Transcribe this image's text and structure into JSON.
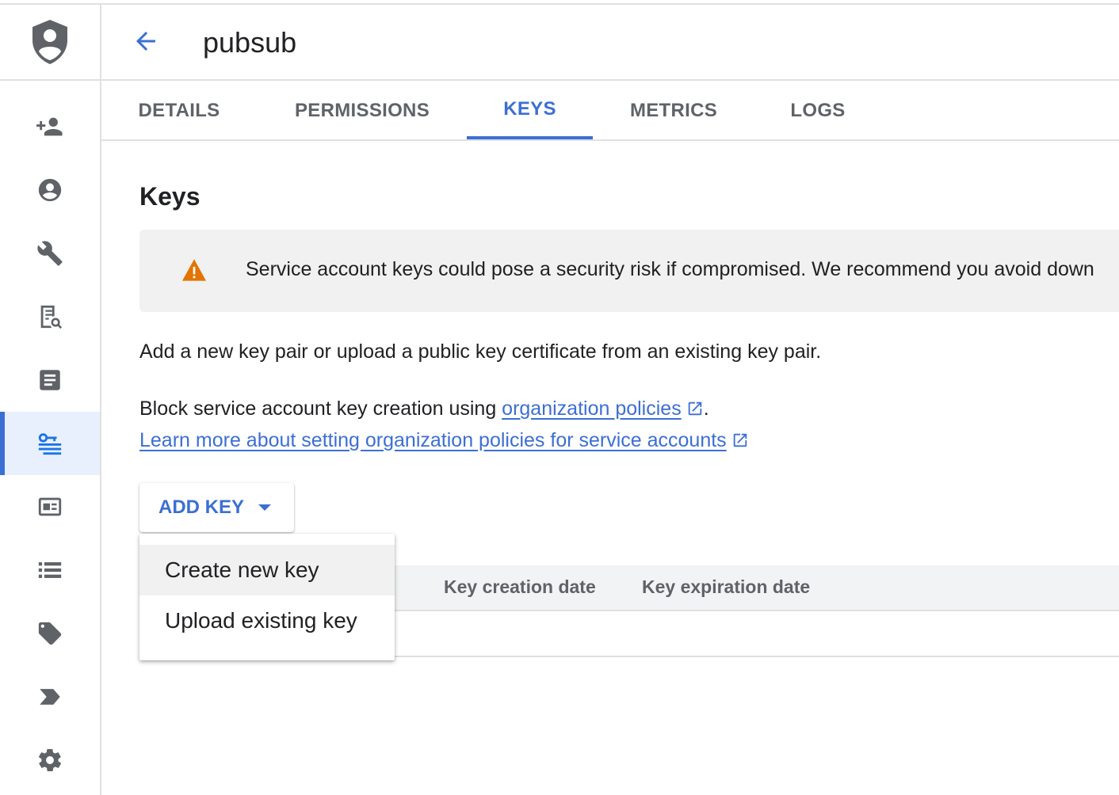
{
  "header": {
    "title": "pubsub"
  },
  "tabs": [
    {
      "label": "DETAILS"
    },
    {
      "label": "PERMISSIONS"
    },
    {
      "label": "KEYS"
    },
    {
      "label": "METRICS"
    },
    {
      "label": "LOGS"
    }
  ],
  "active_tab": "KEYS",
  "keys": {
    "title": "Keys",
    "warning": "Service account keys could pose a security risk if compromised. We recommend you avoid down",
    "description": "Add a new key pair or upload a public key certificate from an existing key pair.",
    "block_prefix": "Block service account key creation using ",
    "org_policies_link": "organization policies",
    "block_suffix": ".",
    "learn_more_link": "Learn more about setting organization policies for service accounts",
    "add_key_label": "ADD KEY"
  },
  "menu": {
    "items": [
      {
        "label": "Create new key"
      },
      {
        "label": "Upload existing key"
      }
    ]
  },
  "table": {
    "columns": [
      "Key creation date",
      "Key expiration date"
    ]
  },
  "colors": {
    "accent": "#3c6fd4",
    "warning": "#e37400"
  },
  "sidebar": {
    "icons": [
      "person-add-icon",
      "account-circle-icon",
      "wrench-icon",
      "document-search-icon",
      "article-icon",
      "vpn-key-icon",
      "badge-icon",
      "list-icon",
      "tag-icon",
      "label-arrow-icon",
      "settings-icon"
    ]
  }
}
